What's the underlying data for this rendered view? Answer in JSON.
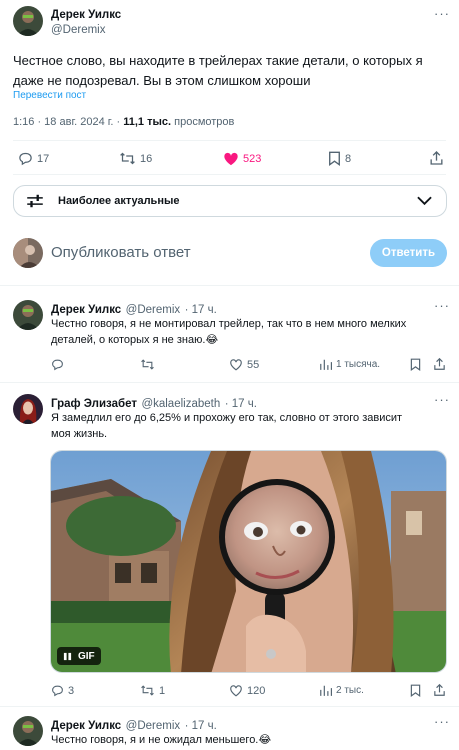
{
  "main_post": {
    "author_name": "Дерек Уилкс",
    "author_handle": "@Deremix",
    "text": "Честное слово, вы находите в трейлерах такие детали, о которых я даже не подозревал. Вы в этом слишком хороши",
    "translate_label": "Перевести пост",
    "time": "1:16 · 18 авг. 2024 г. · ",
    "views_count": "11,1 тыс.",
    "views_label": " просмотров",
    "replies": "17",
    "reposts": "16",
    "likes": "523",
    "bookmarks": "8"
  },
  "sort": {
    "label": "Наиболее актуальные"
  },
  "reply_box": {
    "placeholder": "Опубликовать ответ",
    "button_label": "Ответить"
  },
  "replies": [
    {
      "author_name": "Дерек Уилкс",
      "author_handle": "@Deremix",
      "time": "· 17 ч.",
      "text": "Честно говоря, я не монтировал трейлер, так что в нем много мелких деталей, о которых я не знаю.😂",
      "replies": "",
      "reposts": "",
      "likes": "55",
      "views": "1 тысяча."
    },
    {
      "author_name": "Граф Элизабет",
      "author_handle": "@kalaelizabeth",
      "time": "· 17 ч.",
      "text": "Я замедлил его до 6,25% и прохожу его так, словно от этого зависит моя жизнь.",
      "media_badge": "GIF",
      "replies": "3",
      "reposts": "1",
      "likes": "120",
      "views": "2 тыс."
    },
    {
      "author_name": "Дерек Уилкс",
      "author_handle": "@Deremix",
      "time": "· 17 ч.",
      "text": "Честно говоря, я и не ожидал меньшего.😂"
    }
  ],
  "colors": {
    "like_active": "#f91880",
    "accent": "#1d9bf0",
    "reply_button_disabled": "#8ecdf8"
  }
}
